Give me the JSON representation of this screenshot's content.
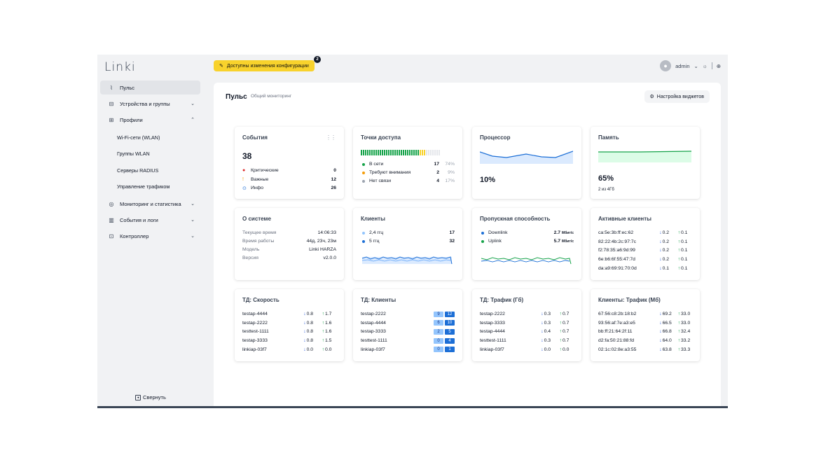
{
  "app": {
    "logo": "Linki"
  },
  "topbar": {
    "banner_text": "Доступны изменения конфигурации",
    "banner_count": "2",
    "user_name": "admin"
  },
  "sidebar": {
    "items": [
      {
        "label": "Пульс",
        "icon": "pulse-icon",
        "active": true
      },
      {
        "label": "Устройства и группы",
        "icon": "devices-icon"
      },
      {
        "label": "Профили",
        "icon": "profiles-icon",
        "expanded": true
      },
      {
        "label": "Мониторинг и статистика",
        "icon": "monitoring-icon"
      },
      {
        "label": "События и логи",
        "icon": "logs-icon"
      },
      {
        "label": "Контроллер",
        "icon": "controller-icon"
      }
    ],
    "subitems": [
      "Wi-Fi-сети (WLAN)",
      "Группы WLAN",
      "Серверы RADIUS",
      "Управление трафиком"
    ],
    "collapse_label": "Свернуть"
  },
  "page": {
    "title": "Пульс",
    "subtitle": "Общий мониторинг",
    "widget_button": "Настройка виджетов"
  },
  "cards": {
    "events": {
      "title": "События",
      "total": "38",
      "rows": [
        {
          "label": "Критические",
          "value": "0"
        },
        {
          "label": "Важные",
          "value": "12"
        },
        {
          "label": "Инфо",
          "value": "26"
        }
      ]
    },
    "ap": {
      "title": "Точки доступа",
      "online_fraction": 0.74,
      "warning_fraction": 0.09,
      "rows": [
        {
          "label": "В сети",
          "value": "17",
          "pct": "74%"
        },
        {
          "label": "Требуют внимания",
          "value": "2",
          "pct": "9%"
        },
        {
          "label": "Нет связи",
          "value": "4",
          "pct": "17%"
        }
      ]
    },
    "cpu": {
      "title": "Процессор",
      "value": "10%"
    },
    "mem": {
      "title": "Память",
      "value": "65%",
      "sub": "2 из 4Гб"
    },
    "system": {
      "title": "О системе",
      "rows": [
        {
          "label": "Текущее время",
          "value": "14:06:33"
        },
        {
          "label": "Время работы",
          "value": "44д, 23ч, 23м"
        },
        {
          "label": "Модель",
          "value": "Linki HARZA"
        },
        {
          "label": "Версия",
          "value": "v2.0.0"
        }
      ]
    },
    "clients": {
      "title": "Клиенты",
      "rows": [
        {
          "label": "2,4 ггц",
          "value": "17"
        },
        {
          "label": "5 ггц",
          "value": "32"
        }
      ]
    },
    "throughput": {
      "title": "Пропускная способность",
      "rows": [
        {
          "label": "Downlink",
          "value": "2.7",
          "unit": "Мбит/с"
        },
        {
          "label": "Uplink",
          "value": "5.7",
          "unit": "Мбит/с"
        }
      ]
    },
    "active": {
      "title": "Активные клиенты",
      "rows": [
        {
          "mac": "ca:5e:3b:ff:ec:62",
          "down": "0.2",
          "up": "0.1"
        },
        {
          "mac": "82:22:4b:2c:97:7c",
          "down": "0.2",
          "up": "0.1"
        },
        {
          "mac": "f2:78:35:a6:9d:99",
          "down": "0.2",
          "up": "0.1"
        },
        {
          "mac": "6e:b6:6f:55:47:7d",
          "down": "0.2",
          "up": "0.1"
        },
        {
          "mac": "da:a9:69:91:70:0d",
          "down": "0.1",
          "up": "0.1"
        }
      ]
    },
    "ap_speed": {
      "title": "ТД: Скорость",
      "rows": [
        {
          "name": "testap-4444",
          "down": "0.8",
          "up": "1.7"
        },
        {
          "name": "testap-2222",
          "down": "0.8",
          "up": "1.6"
        },
        {
          "name": "testtest-1111",
          "down": "0.8",
          "up": "1.6"
        },
        {
          "name": "testap-3333",
          "down": "0.8",
          "up": "1.5"
        },
        {
          "name": "linkiap-03f7",
          "down": "0.0",
          "up": "0.0"
        }
      ]
    },
    "ap_clients": {
      "title": "ТД: Клиенты",
      "rows": [
        {
          "name": "testap-2222",
          "a": "9",
          "b": "12"
        },
        {
          "name": "testap-4444",
          "a": "6",
          "b": "10"
        },
        {
          "name": "testap-3333",
          "a": "2",
          "b": "5"
        },
        {
          "name": "testtest-1111",
          "a": "0",
          "b": "4"
        },
        {
          "name": "linkiap-03f7",
          "a": "0",
          "b": "1"
        }
      ]
    },
    "ap_traffic": {
      "title": "ТД: Трафик (Гб)",
      "rows": [
        {
          "name": "testap-2222",
          "down": "0.3",
          "up": "0.7"
        },
        {
          "name": "testap-3333",
          "down": "0.3",
          "up": "0.7"
        },
        {
          "name": "testap-4444",
          "down": "0.4",
          "up": "0.7"
        },
        {
          "name": "testtest-1111",
          "down": "0.3",
          "up": "0.7"
        },
        {
          "name": "linkiap-03f7",
          "down": "0.0",
          "up": "0.0"
        }
      ]
    },
    "client_traffic": {
      "title": "Клиенты: Трафик (Мб)",
      "rows": [
        {
          "mac": "67:56:c8:2b:18:b2",
          "down": "69.2",
          "up": "33.0"
        },
        {
          "mac": "93:56:af:7e:a3:e5",
          "down": "66.5",
          "up": "33.0"
        },
        {
          "mac": "bb:ff:21:64:2f:11",
          "down": "66.8",
          "up": "32.4"
        },
        {
          "mac": "d2:fa:50:21:88:fd",
          "down": "64.0",
          "up": "33.2"
        },
        {
          "mac": "02:1c:02:8e:a3:55",
          "down": "63.8",
          "up": "33.3"
        }
      ]
    }
  },
  "colors": {
    "accent": "#f8d22c",
    "green": "#16a34a",
    "blue": "#1d6fd6",
    "red": "#dc2626",
    "amber": "#f59e0b"
  }
}
